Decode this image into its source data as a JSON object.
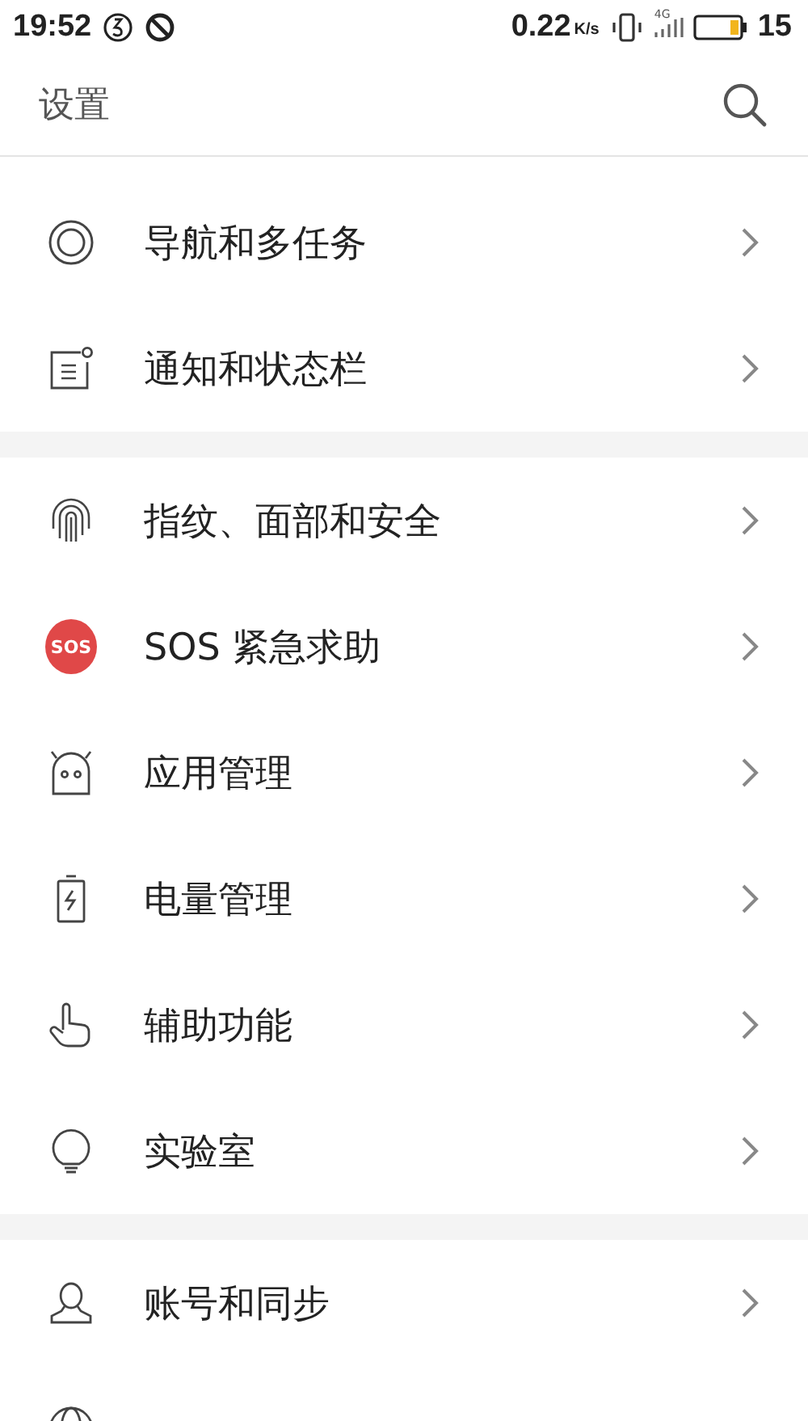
{
  "status_bar": {
    "time": "19:52",
    "speed": "0.22",
    "speed_unit": "K/s",
    "network": "4G",
    "battery": "15"
  },
  "header": {
    "title": "设置"
  },
  "sections": [
    {
      "items": [
        {
          "label": "导航和多任务"
        },
        {
          "label": "通知和状态栏"
        }
      ]
    },
    {
      "items": [
        {
          "label": "指纹、面部和安全"
        },
        {
          "label": "SOS 紧急求助",
          "badge": "SOS"
        },
        {
          "label": "应用管理"
        },
        {
          "label": "电量管理"
        },
        {
          "label": "辅助功能"
        },
        {
          "label": "实验室"
        }
      ]
    },
    {
      "items": [
        {
          "label": "账号和同步"
        }
      ]
    }
  ]
}
